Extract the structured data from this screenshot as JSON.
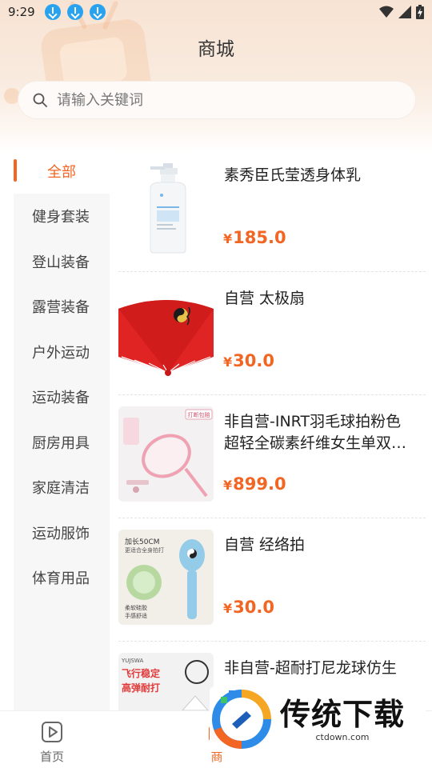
{
  "status_bar": {
    "time": "9:29"
  },
  "header": {
    "title": "商城"
  },
  "search": {
    "placeholder": "请输入关键词"
  },
  "sidebar": {
    "items": [
      {
        "label": "全部",
        "active": true
      },
      {
        "label": "健身套装"
      },
      {
        "label": "登山装备"
      },
      {
        "label": "露营装备"
      },
      {
        "label": "户外运动"
      },
      {
        "label": "运动装备"
      },
      {
        "label": "厨房用具"
      },
      {
        "label": "家庭清洁"
      },
      {
        "label": "运动服饰"
      },
      {
        "label": "体育用品"
      }
    ]
  },
  "products": [
    {
      "name": "素秀臣氏莹透身体乳",
      "currency": "¥",
      "price": "185.0",
      "image": "lotion-bottle"
    },
    {
      "name": "自营 太极扇",
      "currency": "¥",
      "price": "30.0",
      "image": "red-taichi-fan"
    },
    {
      "name": "非自营-INRT羽毛球拍粉色超轻全碳素纤维女生单双…",
      "currency": "¥",
      "price": "899.0",
      "image": "pink-badminton-racket",
      "image_text": [
        "打断包赔"
      ]
    },
    {
      "name": "自营 经络拍",
      "currency": "¥",
      "price": "30.0",
      "image": "meridian-paddle",
      "image_text": [
        "加长50CM",
        "更适合全身拍打",
        "柔软硅胶",
        "手感舒适"
      ]
    },
    {
      "name": "非自营-超耐打尼龙球仿生",
      "currency": "¥",
      "price": "",
      "image": "badminton-shuttlecock",
      "image_text": [
        "YUJSWA",
        "飞行稳定",
        "高弹耐打"
      ]
    }
  ],
  "bottom_nav": {
    "home_label": "首页",
    "mall_label": "商"
  },
  "watermark": {
    "title": "传统下载",
    "url": "ctdown.com"
  },
  "colors": {
    "accent": "#f26522",
    "status_icon_blue": "#29a3f0",
    "sidebar_bg": "#f7f7f7"
  }
}
